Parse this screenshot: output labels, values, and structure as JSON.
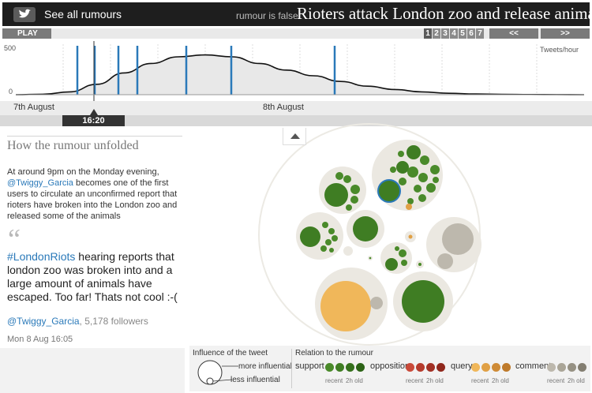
{
  "header": {
    "see_all": "See all rumours",
    "status": "rumour is false",
    "headline": "Rioters attack London zoo and release animals"
  },
  "controls": {
    "play": "PLAY",
    "pages": [
      "1",
      "2",
      "3",
      "4",
      "5",
      "6",
      "7"
    ],
    "active_page": 1,
    "prev": "<<",
    "next": ">>"
  },
  "timeline": {
    "y_max_label": "500",
    "y_min_label": "0",
    "unit_label": "Tweets/hour",
    "day_labels": [
      "7th August",
      "8th August"
    ],
    "current_time": "16:20"
  },
  "chart_data": {
    "type": "area",
    "ylabel": "Tweets/hour",
    "ylim": [
      0,
      500
    ],
    "x_markers": [
      "7th August",
      "8th August"
    ],
    "series": [
      {
        "values": [
          0,
          5,
          30,
          110,
          230,
          330,
          400,
          420,
          400,
          330,
          260,
          200,
          140,
          90,
          55,
          30,
          15,
          8,
          4,
          2,
          1,
          0
        ]
      }
    ]
  },
  "story": {
    "title": "How the rumour unfolded",
    "desc_pre": "At around 9pm on the Monday evening,",
    "desc_user": "@Twiggy_Garcia",
    "desc_post": "becomes one of the first users to circulate an unconfirmed report that rioters have broken into the London zoo and released some of the animals",
    "quote_mark": "“",
    "tweet_tag": "#LondonRiots",
    "tweet_text": "hearing reports that london zoo was broken into and a large amount of animals have escaped. Too far! Thats not cool :-(",
    "author_user": "@Twiggy_Garcia",
    "author_followers": ", 5,178 followers",
    "date": "Mon 8 Aug 16:05"
  },
  "legend": {
    "influence_title": "Influence of the tweet",
    "more": "more influential",
    "less": "less influential",
    "relation_title": "Relation to the rumour",
    "support": "support",
    "opposition": "opposition",
    "query": "query",
    "comment": "comment",
    "recent": "recent",
    "old": "2h old",
    "colors": {
      "support": [
        "#4a8a2a",
        "#3f7d23",
        "#35701c",
        "#2c6316"
      ],
      "opposition": [
        "#c94a3a",
        "#b53b2d",
        "#a23125",
        "#90281d"
      ],
      "query": [
        "#f0b75a",
        "#e0a045",
        "#cf8b36",
        "#be7a2b"
      ],
      "comment": [
        "#bdb8ad",
        "#aaa597",
        "#969183",
        "#837e71"
      ]
    }
  }
}
